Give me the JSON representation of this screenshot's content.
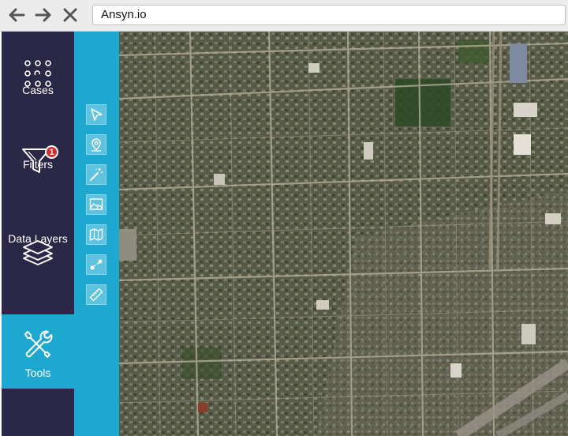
{
  "browser": {
    "url": "Ansyn.io",
    "back_icon": "arrow-left-icon",
    "forward_icon": "arrow-right-icon",
    "close_icon": "close-icon"
  },
  "sidebar": {
    "items": [
      {
        "label": "Cases",
        "icon": "dots-grid-icon"
      },
      {
        "label": "Filters",
        "icon": "funnel-icon",
        "badge": "1"
      },
      {
        "label": "Data Layers",
        "icon": "layers-icon"
      },
      {
        "label": "Tools",
        "icon": "wrench-screwdriver-icon",
        "active": true
      }
    ]
  },
  "tools": [
    {
      "icon": "pointer-icon"
    },
    {
      "icon": "location-pin-icon"
    },
    {
      "icon": "magic-wand-icon"
    },
    {
      "icon": "image-settings-icon"
    },
    {
      "icon": "map-icon"
    },
    {
      "icon": "measure-points-icon"
    },
    {
      "icon": "ruler-icon"
    }
  ],
  "map": {
    "icon": "satellite-map-image"
  },
  "colors": {
    "sidebar": "#2a2846",
    "accent": "#1fa8cf",
    "badge": "#d52b2b"
  }
}
